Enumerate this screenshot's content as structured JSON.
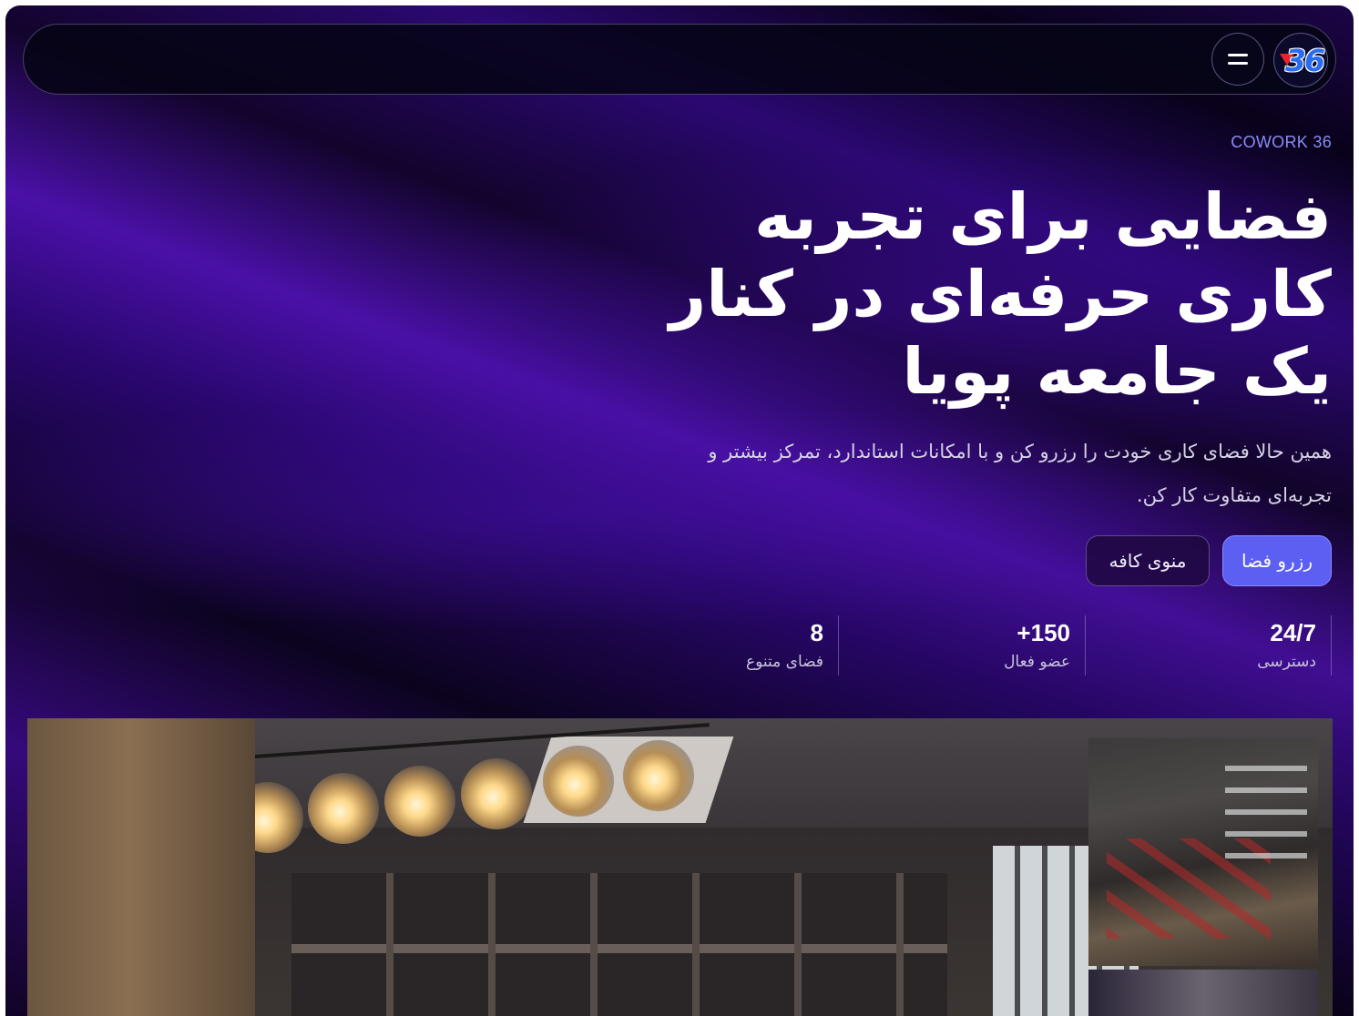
{
  "brand": {
    "logo_icon": "cowork-36-logo",
    "eyebrow": "COWORK 36"
  },
  "nav": {
    "menu_icon": "hamburger-menu-icon"
  },
  "hero": {
    "title": "فضایی برای تجربه کاری حرفه‌ای در کنار یک جامعه پویا",
    "subtitle": "همین حالا فضای کاری خودت را رزرو کن و با امکانات استاندارد، تمرکز بیشتر و تجربه‌ای متفاوت کار کن.",
    "primary_button": "رزرو فضا",
    "secondary_button": "منوی کافه"
  },
  "stats": [
    {
      "value": "24/7",
      "label": "دسترسی"
    },
    {
      "value": "+150",
      "label": "عضو فعال"
    },
    {
      "value": "8",
      "label": "فضای متنوع"
    }
  ],
  "colors": {
    "accent": "#5b5ff2",
    "eyebrow": "#8a8cf6",
    "background": "#1a0640"
  }
}
